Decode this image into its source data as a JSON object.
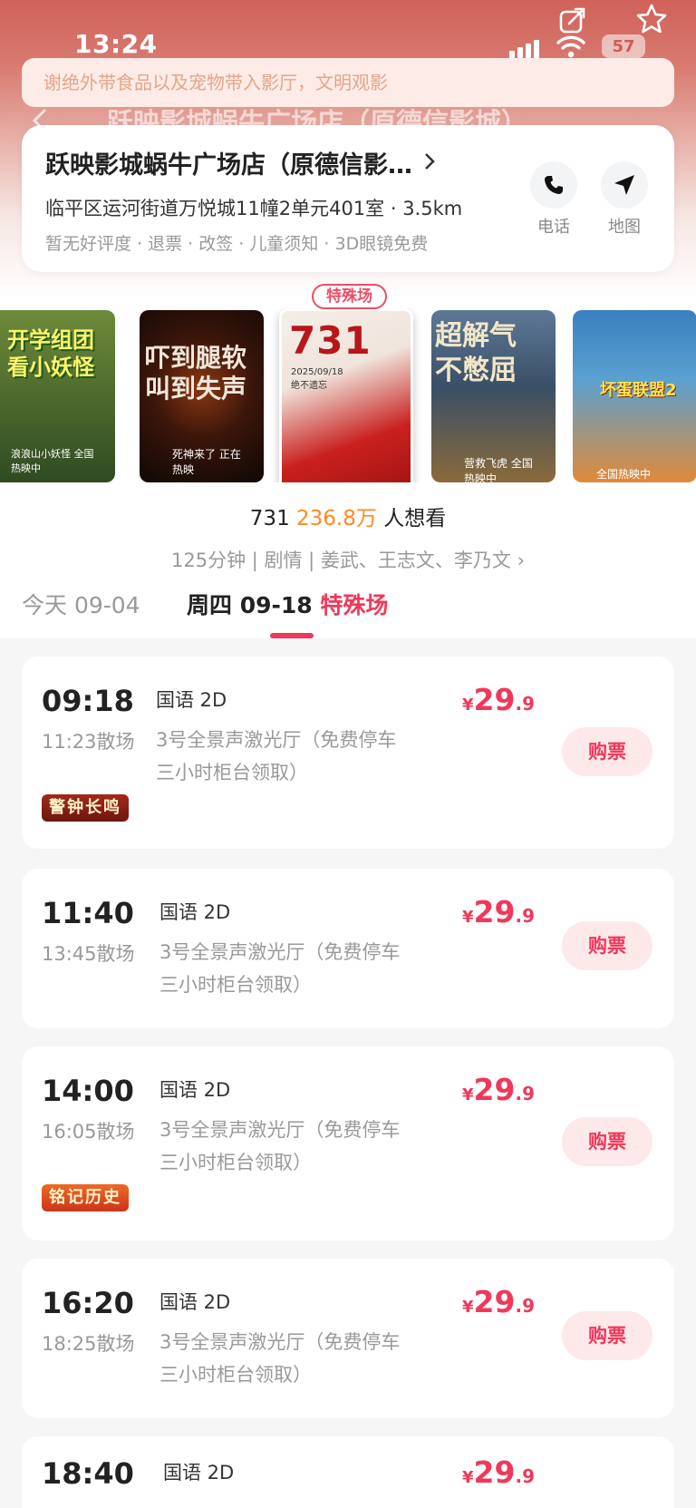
{
  "status_bar": {
    "time": "13:24",
    "battery": "57"
  },
  "notice": "谢绝外带食品以及宠物带入影厅，文明观影",
  "ghost_title": "跃映影城蜗牛广场店（原德信影城）",
  "cinema": {
    "name": "跃映影城蜗牛广场店（原德信影…",
    "address": "临平区运河街道万悦城11幢2单元401室 · 3.5km",
    "tags": "暂无好评度 · 退票 · 改签 · 儿童须知 · 3D眼镜免费",
    "phone_label": "电话",
    "map_label": "地图"
  },
  "posters": [
    {
      "title": "开学组团看小妖怪",
      "sub": "浪浪山小妖怪 全国热映中",
      "color_from": "#2f4a22",
      "color_to": "#8fa13a"
    },
    {
      "title": "吓到腿软 叫到失声",
      "sub": "死神来了 正在热映",
      "color_from": "#1a0e08",
      "color_to": "#6b2a10"
    },
    {
      "title": "731",
      "sub": "2025/09/18 绝不遗忘",
      "color_from": "#f3ede6",
      "color_to": "#c02020"
    },
    {
      "title": "超解气 不憋屈",
      "sub": "营救飞虎 全国热映中",
      "color_from": "#3b5470",
      "color_to": "#a9834a"
    },
    {
      "title": "坏蛋联盟2",
      "sub": "全国热映中",
      "color_from": "#2d6fa8",
      "color_to": "#e0893a"
    }
  ],
  "special_badge": "特殊场",
  "movie": {
    "name": "731",
    "want_count": "236.8万",
    "want_suffix": "人想看",
    "meta": "125分钟 | 剧情 | 姜武、王志文、李乃文 ›"
  },
  "date_tabs": [
    {
      "label": "今天 09-04"
    },
    {
      "label": "周四 09-18",
      "special": "特殊场"
    }
  ],
  "sessions": [
    {
      "time": "09:18",
      "end": "11:23散场",
      "lang": "国语 2D",
      "hall_line1": "3号全景声激光厅（免费停车",
      "hall_line2": "三小时柜台领取）",
      "price_yen": "¥",
      "price_int": "29",
      "price_dec": ".9",
      "buy": "购票",
      "tag": "警钟长鸣"
    },
    {
      "time": "11:40",
      "end": "13:45散场",
      "lang": "国语 2D",
      "hall_line1": "3号全景声激光厅（免费停车",
      "hall_line2": "三小时柜台领取）",
      "price_yen": "¥",
      "price_int": "29",
      "price_dec": ".9",
      "buy": "购票"
    },
    {
      "time": "14:00",
      "end": "16:05散场",
      "lang": "国语 2D",
      "hall_line1": "3号全景声激光厅（免费停车",
      "hall_line2": "三小时柜台领取）",
      "price_yen": "¥",
      "price_int": "29",
      "price_dec": ".9",
      "buy": "购票",
      "tag": "铭记历史"
    },
    {
      "time": "16:20",
      "end": "18:25散场",
      "lang": "国语 2D",
      "hall_line1": "3号全景声激光厅（免费停车",
      "hall_line2": "三小时柜台领取）",
      "price_yen": "¥",
      "price_int": "29",
      "price_dec": ".9",
      "buy": "购票"
    },
    {
      "time": "18:40",
      "lang": "国语 2D",
      "price_yen": "¥",
      "price_int": "29",
      "price_dec": ".9"
    }
  ],
  "colors": {
    "accent": "#f0385a",
    "want": "#ff8a1e",
    "tag1": "#8c1f18",
    "tag2": "#e0501c"
  }
}
